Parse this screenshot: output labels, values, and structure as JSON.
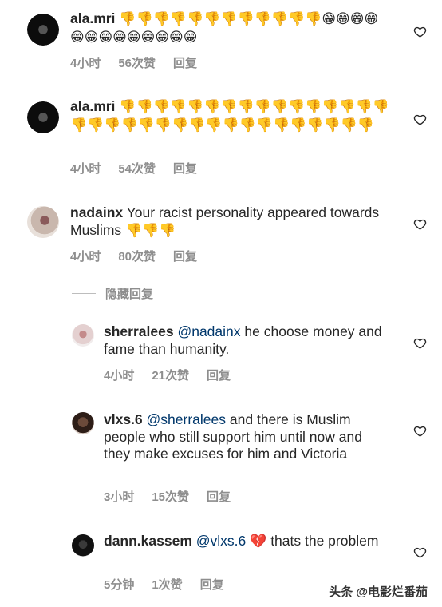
{
  "comments": [
    {
      "username": "ala.mri",
      "text": "👎👎👎👎👎👎👎👎👎👎👎👎😁😁😁😁😁😁😁😁😁😁😁😁😁",
      "time": "4小时",
      "likes": "56次赞",
      "reply": "回复"
    },
    {
      "username": "ala.mri",
      "text": "👎👎👎👎👎👎👎👎👎👎👎👎👎👎👎👎👎👎👎👎👎👎👎👎👎👎👎👎👎👎👎👎👎👎",
      "time": "4小时",
      "likes": "54次赞",
      "reply": "回复"
    },
    {
      "username": "nadainx",
      "text": "Your racist personality appeared towards Muslims",
      "emoji": "👎👎👎",
      "time": "4小时",
      "likes": "80次赞",
      "reply": "回复"
    }
  ],
  "hide_replies": "隐藏回复",
  "replies": [
    {
      "username": "sherralees",
      "mention": "@nadainx",
      "text": "he choose money and fame than humanity.",
      "time": "4小时",
      "likes": "21次赞",
      "reply": "回复"
    },
    {
      "username": "vlxs.6",
      "mention": "@sherralees",
      "text": "and there is Muslim people who still support him until now and they make excuses for him and Victoria",
      "time": "3小时",
      "likes": "15次赞",
      "reply": "回复"
    },
    {
      "username": "dann.kassem",
      "mention": "@vlxs.6",
      "emoji": "💔",
      "text": "thats the problem",
      "time": "5分钟",
      "likes": "1次赞",
      "reply": "回复"
    }
  ],
  "watermark": "头条 @电影烂番茄",
  "icons": {
    "heart": "heart-outline-icon"
  }
}
